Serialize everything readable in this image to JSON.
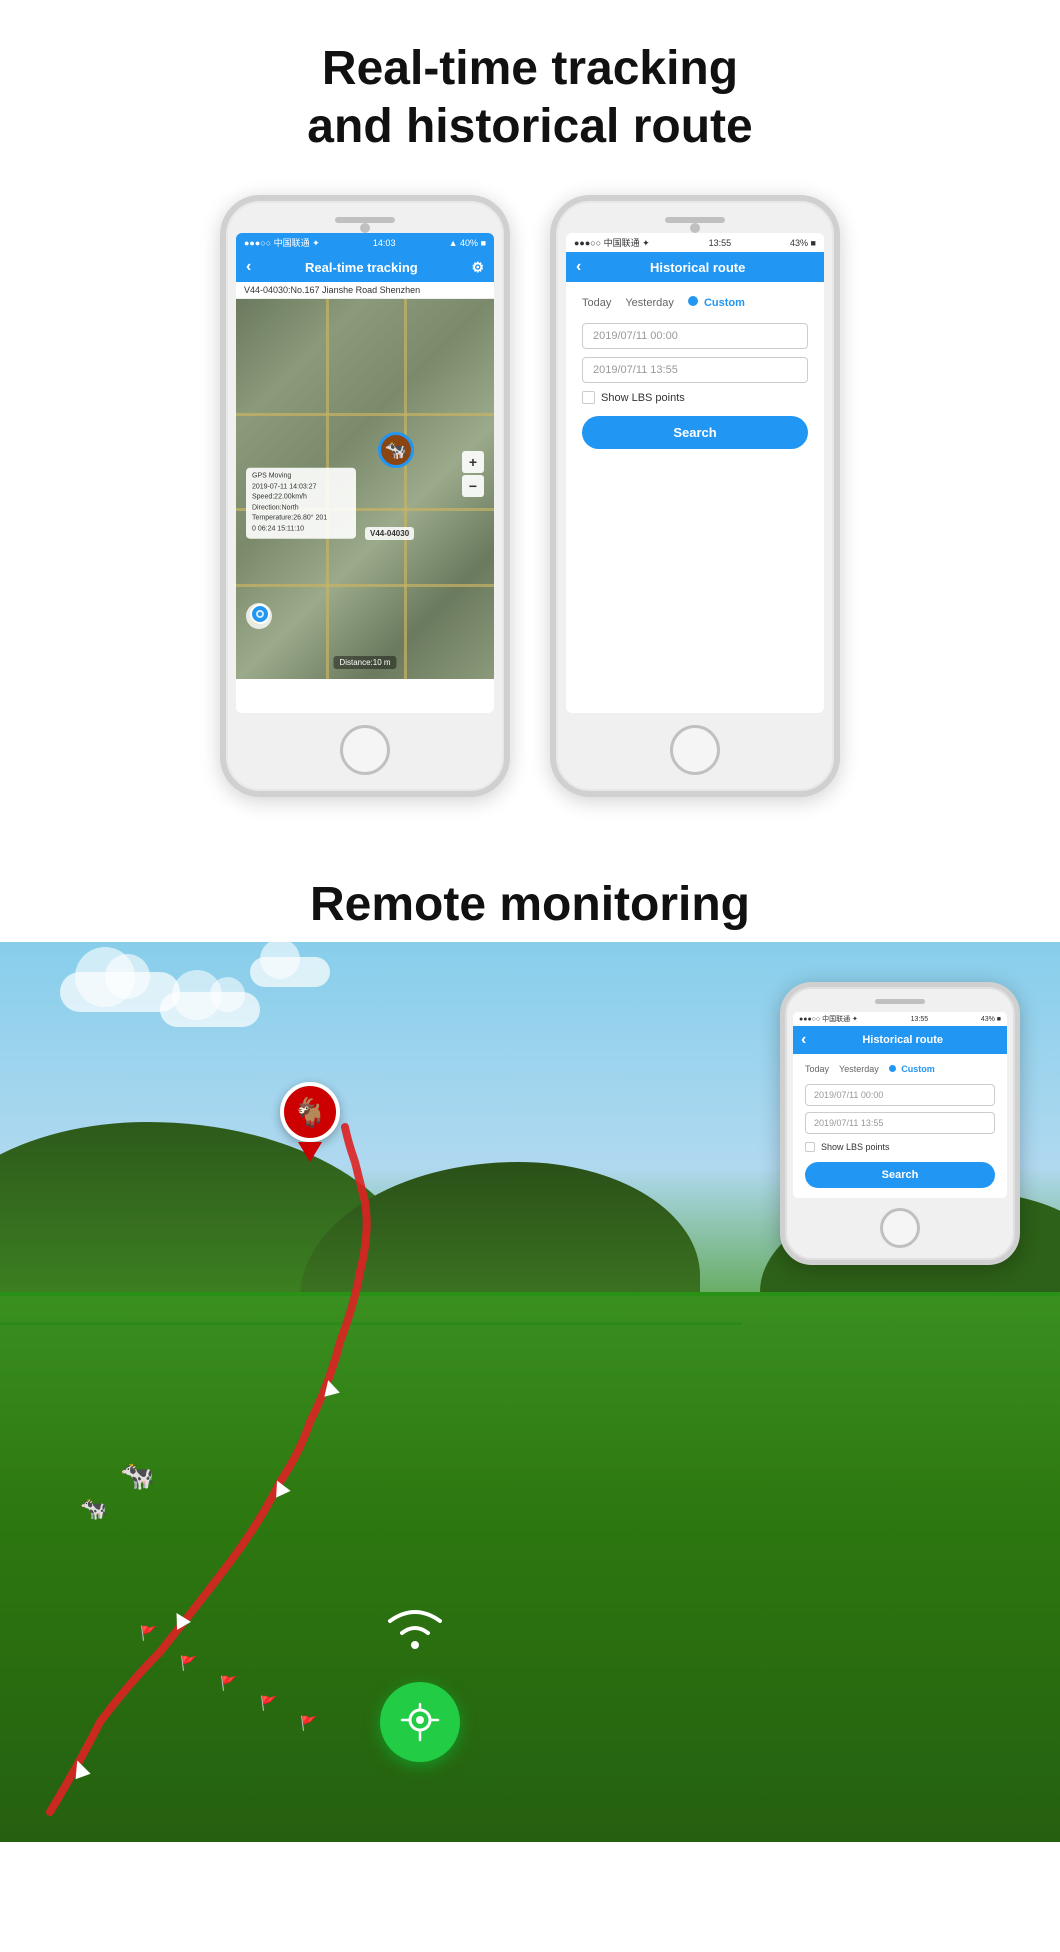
{
  "page": {
    "section1_heading_line1": "Real-time tracking",
    "section1_heading_line2": "and historical route",
    "section2_heading": "Remote monitoring"
  },
  "phone1": {
    "status": {
      "carrier": "●●●○○ 中国联通 ✦",
      "time": "14:03",
      "signal": "▲ 40% ■"
    },
    "header": {
      "back": "‹",
      "title": "Real-time tracking",
      "gear": "⚙"
    },
    "address": "V44-04030:No.167 Jianshe Road Shenzhen",
    "popup": {
      "line1": "GPS Moving",
      "line2": "2019-07-11 14:03:27",
      "line3": "Speed:22.00km/h",
      "line4": "Direction:North",
      "line5": "Temperature:26.80° 201",
      "line6": "0 06:24 15:11:10"
    },
    "tag": "V44-04030",
    "distance": "Distance:10 m"
  },
  "phone2": {
    "status": {
      "carrier": "●●●○○ 中国联通 ✦",
      "time": "13:55",
      "signal": "43% ■"
    },
    "header": {
      "back": "‹",
      "title": "Historical route"
    },
    "tabs": {
      "today": "Today",
      "yesterday": "Yesterday",
      "custom": "Custom"
    },
    "input1": "2019/07/11 00:00",
    "input2": "2019/07/11 13:55",
    "checkbox_label": "Show LBS points",
    "search_button": "Search"
  },
  "phone_landscape": {
    "status": {
      "carrier": "●●●○○ 中国联通 ✦",
      "time": "13:55",
      "signal": "43% ■"
    },
    "header": {
      "back": "‹",
      "title": "Historical route"
    },
    "tabs": {
      "today": "Today",
      "yesterday": "Yesterday",
      "custom": "Custom"
    },
    "input1": "2019/07/11 00:00",
    "input2": "2019/07/11 13:55",
    "checkbox_label": "Show LBS points",
    "search_button": "Search"
  },
  "icons": {
    "back": "‹",
    "gear": "⚙",
    "compass": "◎",
    "wifi": "(((",
    "gps_pin": "📍",
    "goat_emoji": "🐐",
    "cow_emoji": "🐄"
  }
}
